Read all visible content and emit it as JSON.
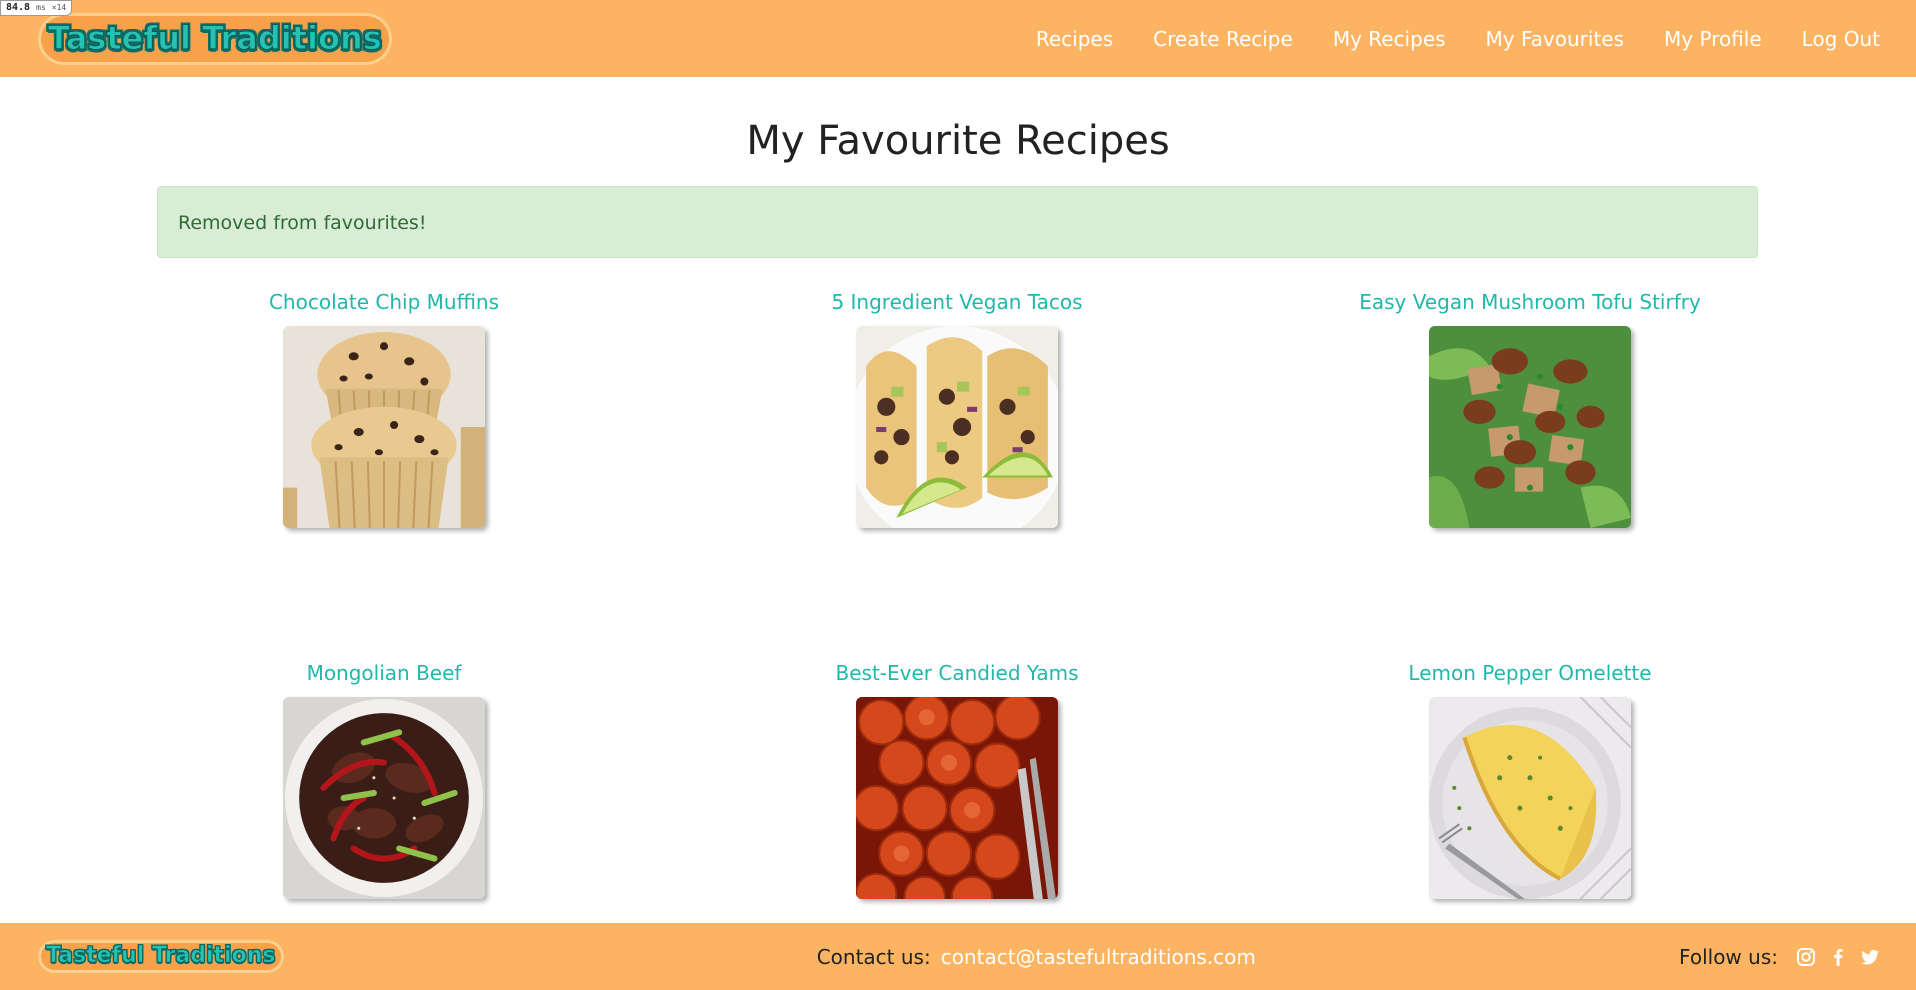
{
  "debug": {
    "timing": "84.8",
    "unit": "ms",
    "count": "×14"
  },
  "brand": {
    "name": "Tasteful Traditions",
    "primary_color": "#fdb462",
    "accent_color": "#1fb8aa"
  },
  "nav": {
    "items": [
      {
        "label": "Recipes"
      },
      {
        "label": "Create Recipe"
      },
      {
        "label": "My Recipes"
      },
      {
        "label": "My Favourites"
      },
      {
        "label": "My Profile"
      },
      {
        "label": "Log Out"
      }
    ]
  },
  "main": {
    "title": "My Favourite Recipes",
    "alert": {
      "message": "Removed from favourites!",
      "type": "success",
      "color": "#d9edd6"
    },
    "recipes": [
      {
        "title": "Chocolate Chip Muffins",
        "image": "muffins-photo"
      },
      {
        "title": "5 Ingredient Vegan Tacos",
        "image": "tacos-photo"
      },
      {
        "title": "Easy Vegan Mushroom Tofu Stirfry",
        "image": "stirfry-photo"
      },
      {
        "title": "Mongolian Beef",
        "image": "beef-photo"
      },
      {
        "title": "Best-Ever Candied Yams",
        "image": "yams-photo"
      },
      {
        "title": "Lemon Pepper Omelette",
        "image": "omelette-photo"
      }
    ]
  },
  "footer": {
    "contact_label": "Contact us:",
    "contact_email": "contact@tastefultraditions.com",
    "follow_label": "Follow us:",
    "social": [
      "instagram-icon",
      "facebook-icon",
      "twitter-icon"
    ]
  }
}
